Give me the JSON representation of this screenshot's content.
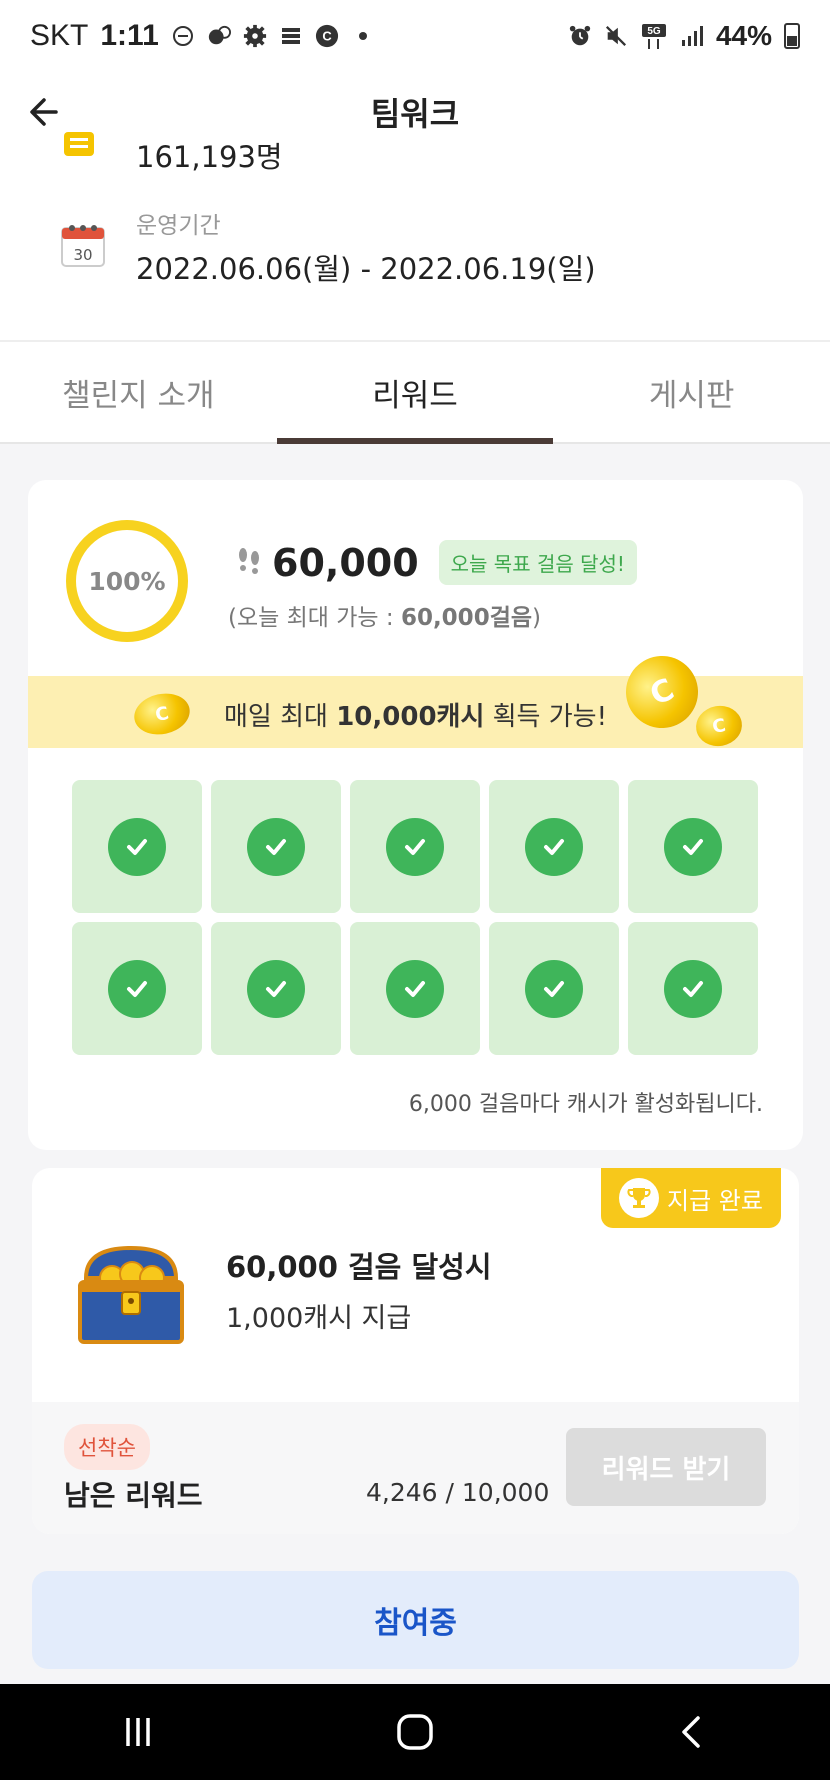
{
  "status_bar": {
    "carrier": "SKT",
    "time": "1:11",
    "network": "5G",
    "battery": "44%"
  },
  "header": {
    "title": "팀워크"
  },
  "info": {
    "participants": "161,193명",
    "period_label": "운영기간",
    "period_value": "2022.06.06(월) - 2022.06.19(일)"
  },
  "tabs": [
    {
      "label": "챌린지 소개",
      "active": false
    },
    {
      "label": "리워드",
      "active": true
    },
    {
      "label": "게시판",
      "active": false
    }
  ],
  "progress": {
    "percent_label": "100%",
    "percent": 100,
    "steps": "60,000",
    "goal_badge": "오늘 목표 걸음 달성!",
    "max_prefix": "(오늘 최대 가능 : ",
    "max_value": "60,000걸음",
    "max_suffix": ")"
  },
  "banner": {
    "prefix": "매일 최대 ",
    "highlight": "10,000캐시",
    "suffix": " 획득 가능!"
  },
  "step_grid": {
    "completed": [
      true,
      true,
      true,
      true,
      true,
      true,
      true,
      true,
      true,
      true
    ]
  },
  "grid_note": "6,000 걸음마다 캐시가 활성화됩니다.",
  "reward": {
    "paid_label": "지급 완료",
    "title": "60,000 걸음 달성시",
    "subtitle": "1,000캐시 지급",
    "first_come_badge": "선착순",
    "remaining_label": "남은 리워드",
    "remaining_value": "4,246 / 10,000",
    "button_label": "리워드 받기"
  },
  "join_button": "참여중",
  "colors": {
    "accent_yellow": "#f7c81b",
    "check_green": "#3fb55a",
    "join_blue": "#1a55c8",
    "tab_indicator": "#4a3b36"
  }
}
